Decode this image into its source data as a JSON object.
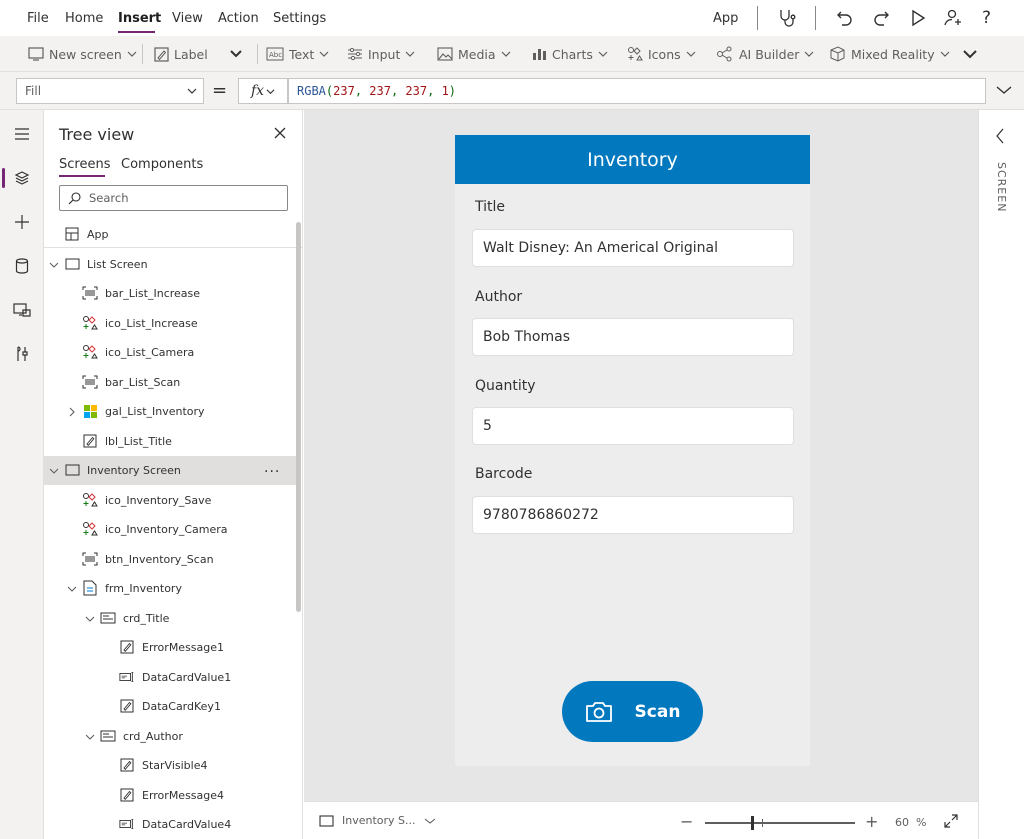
{
  "menubar": {
    "items": [
      "File",
      "Home",
      "Insert",
      "View",
      "Action",
      "Settings"
    ],
    "active": "Insert",
    "app_label": "App"
  },
  "ribbon": {
    "new_screen": "New screen",
    "label": "Label",
    "text": "Text",
    "input": "Input",
    "media": "Media",
    "charts": "Charts",
    "icons": "Icons",
    "ai_builder": "AI Builder",
    "mixed_reality": "Mixed Reality"
  },
  "formula": {
    "property": "Fill",
    "equals": "=",
    "fx": "fx",
    "fn": "RGBA",
    "open": "(",
    "args": [
      "237",
      "237",
      "237",
      "1"
    ],
    "sep": ", ",
    "close": ")"
  },
  "tree": {
    "title": "Tree view",
    "tabs": [
      "Screens",
      "Components"
    ],
    "search_placeholder": "Search",
    "nodes": [
      {
        "label": "App",
        "icon": "app-icon"
      },
      {
        "label": "List Screen",
        "icon": "screen-icon"
      },
      {
        "label": "bar_List_Increase",
        "icon": "barcode-scanner-icon"
      },
      {
        "label": "ico_List_Increase",
        "icon": "icons-control-icon"
      },
      {
        "label": "ico_List_Camera",
        "icon": "icons-control-icon"
      },
      {
        "label": "bar_List_Scan",
        "icon": "barcode-scanner-icon"
      },
      {
        "label": "gal_List_Inventory",
        "icon": "gallery-icon"
      },
      {
        "label": "lbl_List_Title",
        "icon": "label-edit-icon"
      },
      {
        "label": "Inventory Screen",
        "icon": "screen-icon",
        "selected": true
      },
      {
        "label": "ico_Inventory_Save",
        "icon": "icons-control-icon"
      },
      {
        "label": "ico_Inventory_Camera",
        "icon": "icons-control-icon"
      },
      {
        "label": "btn_Inventory_Scan",
        "icon": "barcode-scanner-icon"
      },
      {
        "label": "frm_Inventory",
        "icon": "form-icon"
      },
      {
        "label": "crd_Title",
        "icon": "card-icon"
      },
      {
        "label": "ErrorMessage1",
        "icon": "label-edit-icon"
      },
      {
        "label": "DataCardValue1",
        "icon": "text-input-icon"
      },
      {
        "label": "DataCardKey1",
        "icon": "label-edit-icon"
      },
      {
        "label": "crd_Author",
        "icon": "card-icon"
      },
      {
        "label": "StarVisible4",
        "icon": "label-edit-icon"
      },
      {
        "label": "ErrorMessage4",
        "icon": "label-edit-icon"
      },
      {
        "label": "DataCardValue4",
        "icon": "text-input-icon"
      }
    ],
    "more": "···"
  },
  "app_screen": {
    "header_title": "Inventory",
    "fields": [
      {
        "label": "Title",
        "value": "Walt Disney: An Americal Original"
      },
      {
        "label": "Author",
        "value": "Bob Thomas"
      },
      {
        "label": "Quantity",
        "value": "5"
      },
      {
        "label": "Barcode",
        "value": "9780786860272"
      }
    ],
    "scan_button": "Scan",
    "colors": {
      "header": "#0278be",
      "background": "#ededed"
    }
  },
  "status": {
    "screen_name": "Inventory S...",
    "zoom_minus": "−",
    "zoom_plus": "+",
    "zoom_value": "60",
    "zoom_unit": "%",
    "zoom_level": 60
  },
  "right_panel": {
    "label": "SCREEN"
  }
}
